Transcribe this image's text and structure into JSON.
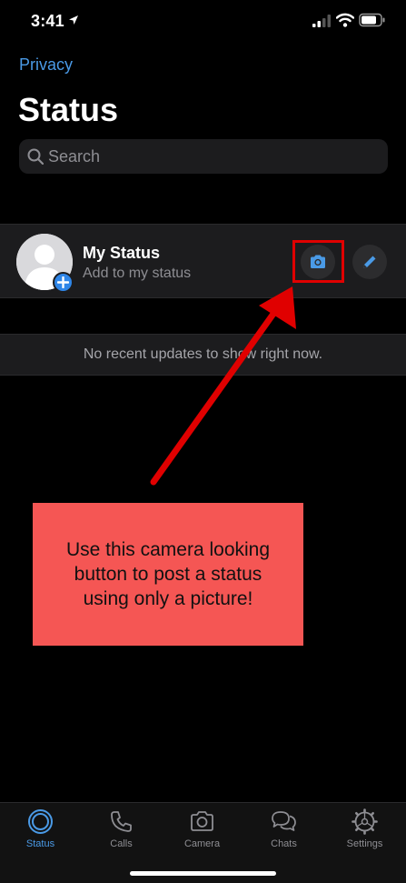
{
  "statusbar": {
    "time": "3:41",
    "icons": [
      "location-arrow-icon",
      "signal-icon",
      "wifi-icon",
      "battery-icon"
    ]
  },
  "header": {
    "privacy_label": "Privacy",
    "title": "Status"
  },
  "search": {
    "placeholder": "Search",
    "value": ""
  },
  "my_status": {
    "name": "My Status",
    "subtitle": "Add to my status",
    "actions": [
      "camera-icon",
      "pencil-icon"
    ]
  },
  "updates": {
    "empty_message": "No recent updates to show right now."
  },
  "annotation": {
    "text": "Use this camera looking button to post a status using only a picture!",
    "color": "#f55654",
    "arrow_color": "#e00000"
  },
  "tabs": [
    {
      "label": "Status",
      "icon": "status-ring-icon",
      "active": true
    },
    {
      "label": "Calls",
      "icon": "phone-icon",
      "active": false
    },
    {
      "label": "Camera",
      "icon": "camera-icon",
      "active": false
    },
    {
      "label": "Chats",
      "icon": "chat-bubbles-icon",
      "active": false
    },
    {
      "label": "Settings",
      "icon": "gear-icon",
      "active": false
    }
  ],
  "colors": {
    "accent": "#4a9ae6",
    "background": "#000000",
    "row": "#1c1c1e"
  }
}
